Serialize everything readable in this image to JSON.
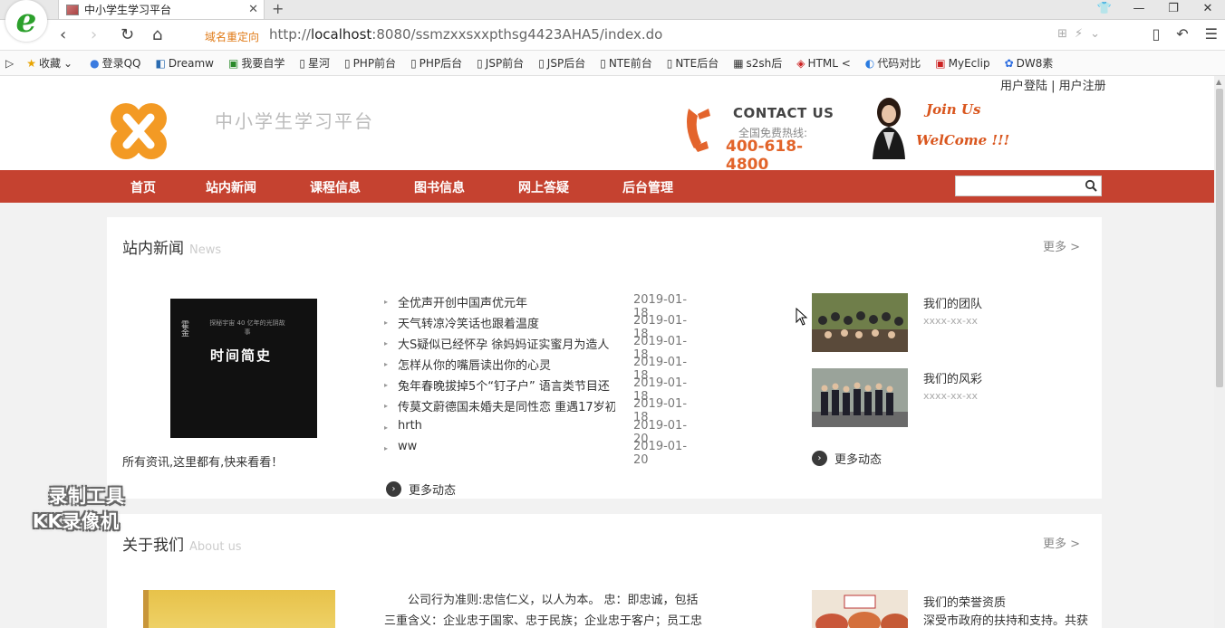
{
  "browser": {
    "tab_title": "中小学生学习平台",
    "tab_close": "✕",
    "new_tab": "+",
    "redirect_label": "域名重定向",
    "url_prefix": "http://",
    "url_host": "localhost",
    "url_rest": ":8080/ssmzxxsxxpthsg4423AHA5/index.do",
    "bookmarks": [
      "收藏",
      "登录QQ",
      "Dreamw",
      "我要自学",
      "星河",
      "PHP前台",
      "PHP后台",
      "JSP前台",
      "JSP后台",
      "NTE前台",
      "NTE后台",
      "s2sh后",
      "HTML <",
      "代码对比",
      "MyEclip",
      "DW8素"
    ]
  },
  "header": {
    "user_links": "用户登陆 | 用户注册",
    "site_title": "中小学生学习平台",
    "contact_title": "CONTACT US",
    "contact_hotline": "全国免费热线:",
    "contact_phone": "400-618-4800",
    "join_us": "Join Us",
    "welcome": "WelCome !!!"
  },
  "nav": {
    "items": [
      "首页",
      "站内新闻",
      "课程信息",
      "图书信息",
      "网上答疑",
      "后台管理"
    ],
    "search_placeholder": ""
  },
  "news_section": {
    "title": "站内新闻",
    "subtitle": "News",
    "more": "更多 >",
    "book_title": "时间简史",
    "book_top": "探秘宇宙 40 亿年的光阴故事",
    "book_spine": "霍金",
    "caption": "所有资讯,这里都有,快来看看！",
    "items": [
      {
        "title": "全优声开创中国声优元年",
        "date": "2019-01-18"
      },
      {
        "title": "天气转凉冷笑话也跟着温度",
        "date": "2019-01-18"
      },
      {
        "title": "大S疑似已经怀孕 徐妈妈证实蜜月为造人",
        "date": "2019-01-18"
      },
      {
        "title": "怎样从你的嘴唇读出你的心灵",
        "date": "2019-01-18"
      },
      {
        "title": "兔年春晚拔掉5个“钉子户” 语言类节目还",
        "date": "2019-01-18"
      },
      {
        "title": "传莫文蔚德国未婚夫是同性恋 重遇17岁初",
        "date": "2019-01-18"
      },
      {
        "title": "hrth",
        "date": "2019-01-20"
      },
      {
        "title": "ww",
        "date": "2019-01-20"
      }
    ],
    "more_dynamic": "更多动态",
    "photos": [
      {
        "label": "我们的团队",
        "date": "xxxx-xx-xx"
      },
      {
        "label": "我们的风彩",
        "date": "xxxx-xx-xx"
      }
    ],
    "photos_more": "更多动态"
  },
  "about_section": {
    "title": "关于我们",
    "subtitle": "About us",
    "more": "更多 >",
    "text": "公司行为准则:忠信仁义，以人为本。 忠：即忠诚，包括三重含义：企业忠于国家、忠于民族；企业忠于客户；员工忠于",
    "honor_title": "我们的荣誉资质",
    "honor_text": "深受市政府的扶持和支持。共获"
  },
  "watermark": {
    "line1": "录制工具",
    "line2": "KK录像机"
  }
}
